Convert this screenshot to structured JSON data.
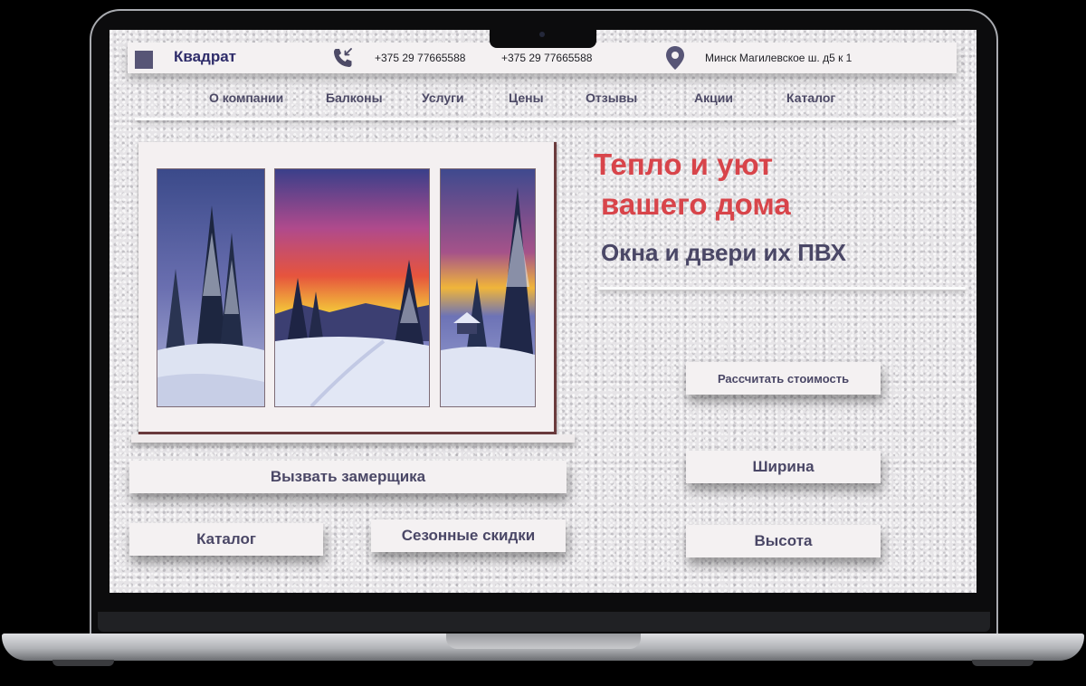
{
  "header": {
    "logo_text": "Квадрат",
    "phone_1": "+375 29 77665588",
    "phone_2": "+375 29 77665588",
    "address": "Минск Магилевское ш. д5 к 1",
    "phone_icon": "phone-incoming-icon",
    "location_icon": "map-pin-icon"
  },
  "nav": {
    "items": [
      {
        "label": "О компании"
      },
      {
        "label": "Балконы"
      },
      {
        "label": "Услуги"
      },
      {
        "label": "Цены"
      },
      {
        "label": "Отзывы"
      },
      {
        "label": "Акции"
      },
      {
        "label": "Каталог"
      }
    ]
  },
  "hero": {
    "title_line1": "Тепло и уют",
    "title_line2": "вашего дома",
    "subtitle": "Окна и двери их ПВХ"
  },
  "buttons": {
    "calculate": "Рассчитать стоимость",
    "call_measurer": "Вызвать замерщика",
    "catalog": "Каталог",
    "seasonal_discounts": "Сезонные скидки",
    "width": "Ширина",
    "height": "Высота"
  },
  "colors": {
    "accent_red": "#d8444a",
    "text_purple": "#4a4766",
    "logo_purple": "#575576",
    "panel": "#f4f1f2"
  }
}
